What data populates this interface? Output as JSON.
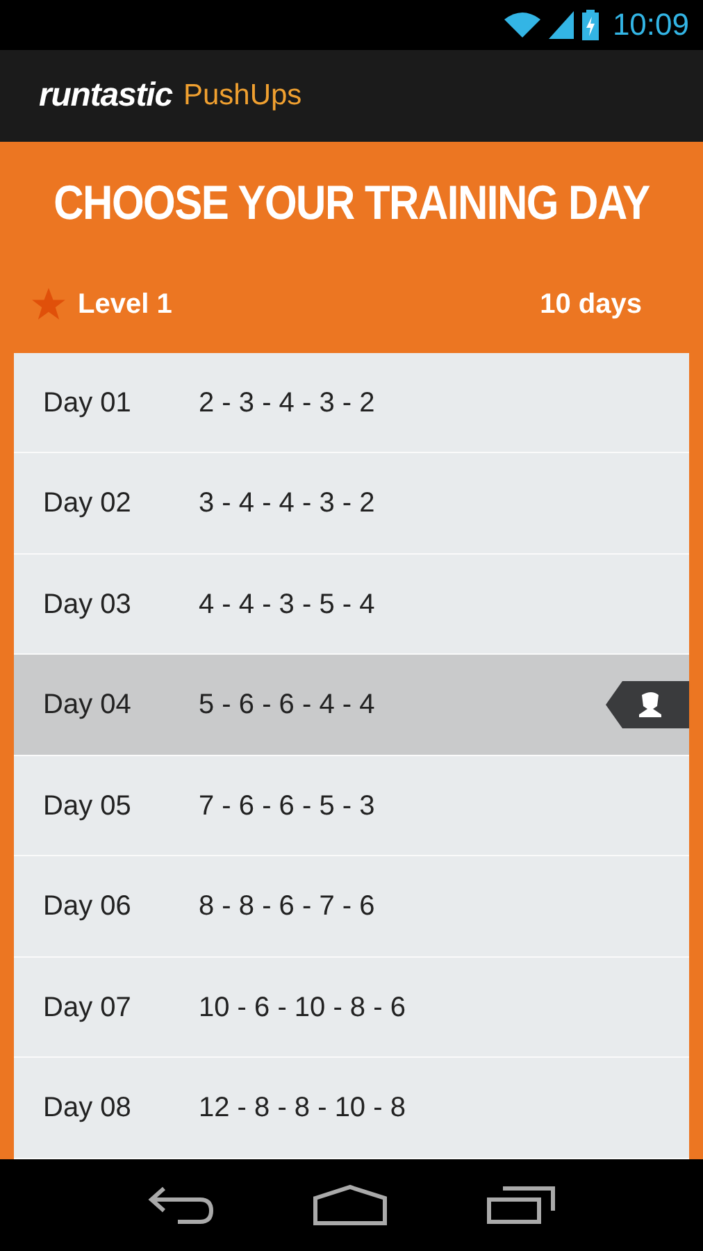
{
  "status_bar": {
    "time": "10:09"
  },
  "app_bar": {
    "brand": "runtastic",
    "product": "PushUps"
  },
  "heading": "CHOOSE YOUR TRAINING DAY",
  "level": {
    "label": "Level 1",
    "duration": "10 days"
  },
  "days": [
    {
      "day": "Day 01",
      "sets": "2 - 3 - 4 - 3 - 2",
      "selected": false
    },
    {
      "day": "Day 02",
      "sets": "3 - 4 - 4 - 3 - 2",
      "selected": false
    },
    {
      "day": "Day 03",
      "sets": "4 - 4 - 3 - 5 - 4",
      "selected": false
    },
    {
      "day": "Day 04",
      "sets": "5 - 6 - 6 - 4 - 4",
      "selected": true
    },
    {
      "day": "Day 05",
      "sets": "7 - 6 - 6 - 5 - 3",
      "selected": false
    },
    {
      "day": "Day 06",
      "sets": "8 - 8 - 6 - 7 - 6",
      "selected": false
    },
    {
      "day": "Day 07",
      "sets": "10 - 6 - 10 - 8 - 6",
      "selected": false
    },
    {
      "day": "Day 08",
      "sets": "12 - 8 - 8 - 10 - 8",
      "selected": false
    }
  ]
}
